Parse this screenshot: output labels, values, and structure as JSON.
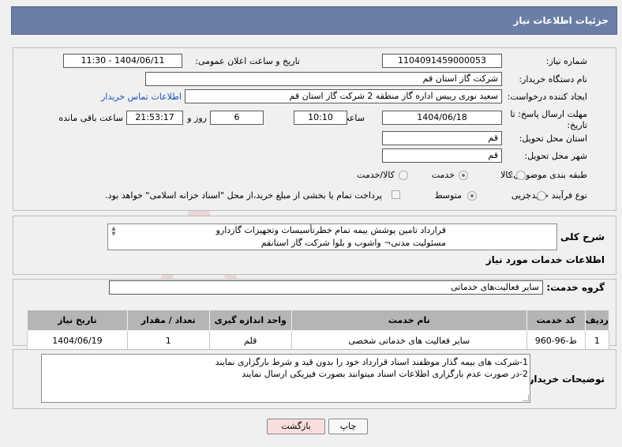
{
  "header": {
    "title": "جزئیات اطلاعات نیاز"
  },
  "form": {
    "need_number_label": "شماره نیاز:",
    "need_number": "1104091459000053",
    "announce_label": "تاریخ و ساعت اعلان عمومی:",
    "announce_value": "1404/06/11 - 11:30",
    "buyer_org_label": "نام دستگاه خریدار:",
    "buyer_org": "شرکت گاز استان قم",
    "creator_label": "ایجاد کننده درخواست:",
    "creator": "سعید نوری رییس اداره گاز منطقه 2 شرکت گاز استان قم",
    "contact_link": "اطلاعات تماس خریدار",
    "deadline_label_1": "مهلت ارسال پاسخ: تا",
    "deadline_label_2": "تاریخ:",
    "deadline_date": "1404/06/18",
    "time_label": "ساعت",
    "deadline_time": "10:10",
    "days": "6",
    "days_label": "روز و",
    "remaining_time": "21:53:17",
    "remaining_label": "ساعت باقی مانده",
    "province_label": "استان محل تحویل:",
    "province": "قم",
    "city_label": "شهر محل تحویل:",
    "city": "قم",
    "category_label": "طبقه بندی موضوعی:",
    "category_options": [
      "کالا",
      "خدمت",
      "کالا/خدمت"
    ],
    "category_selected": "خدمت",
    "process_label": "نوع فرآیند خرید :",
    "process_options": [
      "جزیی",
      "متوسط"
    ],
    "process_selected": "متوسط",
    "payment_note": "پرداخت تمام یا بخشی از مبلغ خرید،از محل \"اسناد خزانه اسلامی\" خواهد بود."
  },
  "summary": {
    "label": "شرح کلی نیاز:",
    "line1": "قرارداد تامین پوشش بیمه تمام خطرتأسیسات وتجهیزات گازدارو",
    "line2": "مسئولیت مدنی¬ واشوب و بلوا شرکت گاز استانقم"
  },
  "services": {
    "section_title": "اطلاعات خدمات مورد نیاز",
    "group_label": "گروه خدمت:",
    "group_value": "سایر فعالیت‌های خدماتی",
    "columns": [
      "ردیف",
      "کد خدمت",
      "نام خدمت",
      "واحد اندازه گیری",
      "تعداد / مقدار",
      "تاریخ نیاز"
    ],
    "rows": [
      [
        "1",
        "ط-96-960",
        "سایر فعالیت های خدماتی شخصی",
        "قلم",
        "1",
        "1404/06/19"
      ]
    ]
  },
  "buyer_notes": {
    "label": "توضیحات خریدار:",
    "line1": "1-شرکت های بیمه گذار موظفند اسناد قرارداد خود را بدون قید و شرط بارگزاری نمایند",
    "line2": "2-در صورت عدم بارگزاری اطلاعات اسناد میتوانند بصورت فیزیکی ارسال نمایند"
  },
  "buttons": {
    "print": "چاپ",
    "back": "بازگشت"
  },
  "watermark": {
    "text": "AriaTender.neT"
  },
  "colors": {
    "header_bg": "#6b7fa6",
    "link": "#1a4fb8",
    "back_button_bg": "#f9dede",
    "watermark": "#c0392b"
  }
}
